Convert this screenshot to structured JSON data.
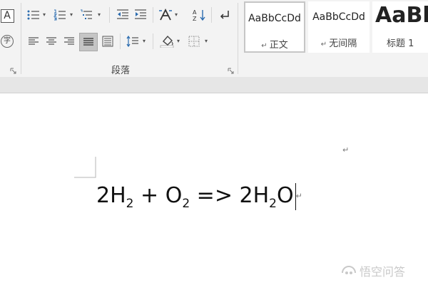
{
  "ribbon": {
    "font_group": {
      "text_style_icon": "A",
      "phonetic_icon": "字"
    },
    "paragraph": {
      "label": "段落",
      "row1": [
        "bullets-icon",
        "numbering-icon",
        "multilevel-list-icon",
        "decrease-indent-icon",
        "increase-indent-icon",
        "chinese-layout-icon",
        "sort-icon",
        "show-marks-icon"
      ],
      "row2": [
        "align-left-icon",
        "align-center-icon",
        "align-right-icon",
        "justify-icon",
        "distributed-icon",
        "line-spacing-icon",
        "shading-icon",
        "borders-icon"
      ]
    },
    "styles": [
      {
        "sample": "AaBbCcDd",
        "name": "正文",
        "selected": true
      },
      {
        "sample": "AaBbCcDd",
        "name": "无间隔",
        "selected": false
      },
      {
        "sample": "AaBb",
        "name": "标题 1",
        "selected": false
      }
    ]
  },
  "document": {
    "formula": {
      "p1": "2H",
      "s1": "2",
      "p2": " + O",
      "s2": "2",
      "p3": " => 2H",
      "s3": "2",
      "p4": "O"
    },
    "paragraph_mark": "↵"
  },
  "watermark": {
    "text": "悟空问答"
  },
  "colors": {
    "ribbon_bg": "#f3f3f3",
    "selected_button": "#c5c5c5",
    "style_selected_border": "#c6c6c6"
  }
}
